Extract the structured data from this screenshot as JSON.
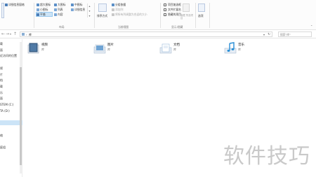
{
  "ribbon": {
    "nav_pane_label": "详细信息窗格",
    "layout_options": [
      "超大图标",
      "大图标",
      "中图标",
      "小图标",
      "列表",
      "详细信息",
      "平铺",
      "内容"
    ],
    "layout_group_label": "布局",
    "sort_by_label": "排序方式",
    "group_by_label": "分组依据",
    "add_columns_label": "添加列",
    "fit_columns_label": "将所有列调整为合适的大小",
    "current_view_group_label": "当前视图",
    "checkboxes": [
      {
        "label": "项目复选框",
        "checked": false
      },
      {
        "label": "文件扩展名",
        "checked": false
      },
      {
        "label": "隐藏的项目",
        "checked": false
      }
    ],
    "hide_selected_label": "隐藏 所选项目",
    "options_label": "选项",
    "show_hide_group_label": "显示/隐藏",
    "selected_layout": "平铺"
  },
  "addressbar": {
    "path_text": "库",
    "search_placeholder": "搜索\"库\""
  },
  "nav": {
    "items": [
      "载",
      "面",
      "近访问的位置",
      "",
      "视",
      "片",
      "档",
      "载",
      "乐",
      "面",
      "STEM (C:)",
      "TA (D:)",
      "",
      "",
      "",
      "络",
      "",
      "庭组",
      "",
      "",
      "",
      ""
    ],
    "selected_index": 13
  },
  "content": {
    "folders": [
      {
        "name": "视频",
        "type": "库",
        "icon": "videos-library-icon",
        "color": "#3b5f86"
      },
      {
        "name": "图片",
        "type": "库",
        "icon": "pictures-library-icon",
        "color": "#6fa4d4"
      },
      {
        "name": "文档",
        "type": "库",
        "icon": "documents-library-icon",
        "color": "#9bbcdc"
      },
      {
        "name": "音乐",
        "type": "库",
        "icon": "music-library-icon",
        "color": "#2a8fd6"
      }
    ]
  },
  "watermark": "软件技巧"
}
